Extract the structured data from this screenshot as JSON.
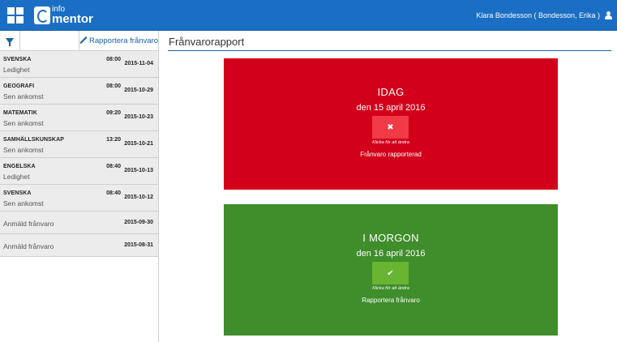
{
  "header": {
    "logo_small": "info",
    "logo_large": "mentor",
    "user_name": "Klara Bondesson ( Bondesson, Erika )"
  },
  "sidebar": {
    "report_label": "Rapportera frånvaro",
    "items": [
      {
        "subject": "SVENSKA",
        "reason": "Ledighet",
        "time": "08:00",
        "date": "2015-11-04"
      },
      {
        "subject": "GEOGRAFI",
        "reason": "Sen ankomst",
        "time": "08:00",
        "date": "2015-10-29"
      },
      {
        "subject": "MATEMATIK",
        "reason": "Sen ankomst",
        "time": "09:20",
        "date": "2015-10-23"
      },
      {
        "subject": "SAMHÄLLSKUNSKAP",
        "reason": "Sen ankomst",
        "time": "13:20",
        "date": "2015-10-21"
      },
      {
        "subject": "ENGELSKA",
        "reason": "Ledighet",
        "time": "08:40",
        "date": "2015-10-13"
      },
      {
        "subject": "SVENSKA",
        "reason": "Sen ankomst",
        "time": "08:40",
        "date": "2015-10-12"
      }
    ],
    "notices": [
      {
        "reason": "Anmäld frånvaro",
        "date": "2015-09-30"
      },
      {
        "reason": "Anmäld frånvaro",
        "date": "2015-08-31"
      }
    ]
  },
  "main": {
    "title": "Frånvarorapport",
    "today": {
      "heading": "IDAG",
      "date": "den 15 april 2016",
      "toggle_glyph": "✖",
      "hint": "Klicka för att ändra",
      "status": "Frånvaro rapporterad",
      "color": "#d2001a"
    },
    "tomorrow": {
      "heading": "I MORGON",
      "date": "den 16 april 2016",
      "toggle_glyph": "✔",
      "hint": "Klicka för att ändra",
      "status": "Rapportera frånvaro",
      "color": "#3f8d2b"
    }
  },
  "colors": {
    "brand": "#1a6fc4",
    "link": "#1a5fa8"
  }
}
